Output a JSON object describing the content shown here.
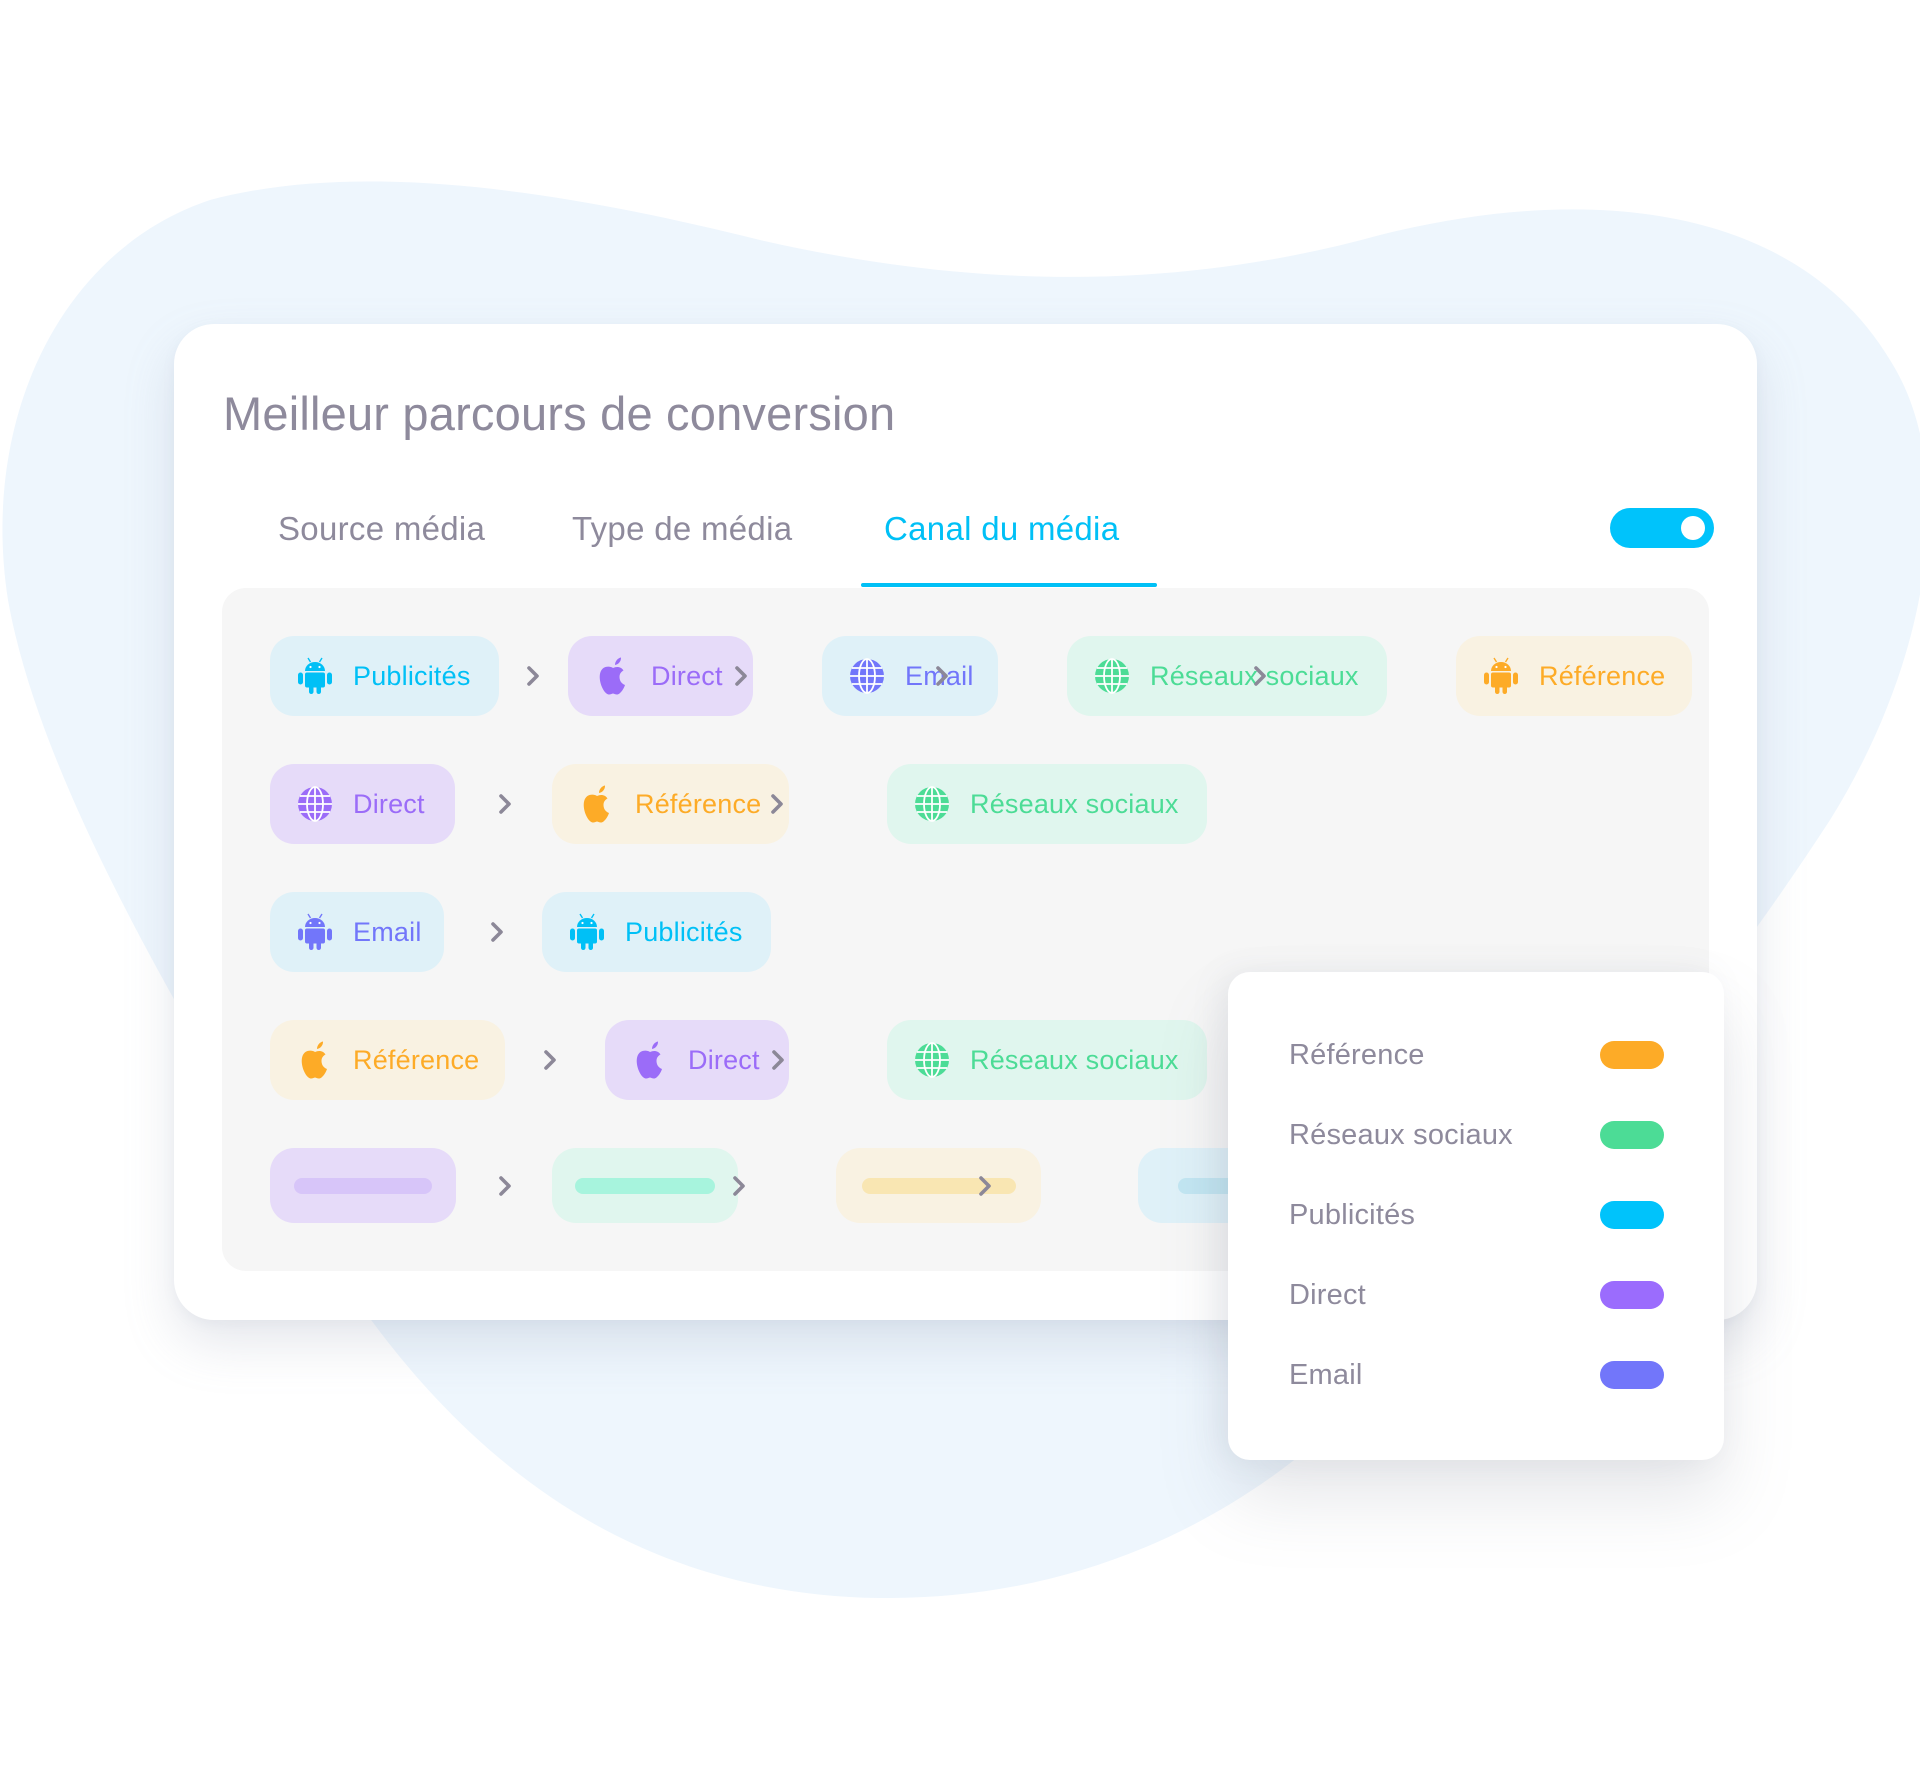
{
  "title": "Meilleur parcours de conversion",
  "tabs": [
    {
      "label": "Source média",
      "active": false
    },
    {
      "label": "Type de média",
      "active": false
    },
    {
      "label": "Canal du média",
      "active": true
    }
  ],
  "toggle": {
    "state": "on",
    "color": "#00c3fb"
  },
  "channels": {
    "publicites": {
      "label": "Publicités",
      "color": "#00c0f6",
      "bg": "#dff1f8",
      "placeholder_bar": "#c2e6f2"
    },
    "direct": {
      "label": "Direct",
      "color": "#9b6cf8",
      "bg": "#e6dbf9",
      "placeholder_bar": "#d7c5f9"
    },
    "email": {
      "label": "Email",
      "color": "#7276fa",
      "bg": "#dff1f8",
      "placeholder_bar": "#c2e6f2"
    },
    "reseaux": {
      "label": "Réseaux sociaux",
      "color": "#4cdc96",
      "bg": "#e0f6ee",
      "placeholder_bar": "#a7f4dd"
    },
    "reference": {
      "label": "Référence",
      "color": "#fdab27",
      "bg": "#f9f2e2",
      "placeholder_bar": "#f9e6b2"
    }
  },
  "paths": [
    {
      "steps": [
        {
          "channel": "publicites",
          "label": "Publicités",
          "icon": "android-icon"
        },
        {
          "channel": "direct",
          "label": "Direct",
          "icon": "apple-icon"
        },
        {
          "channel": "email",
          "label": "Email",
          "icon": "globe-icon"
        },
        {
          "channel": "reseaux",
          "label": "Réseaux sociaux",
          "icon": "globe-icon"
        },
        {
          "channel": "reference",
          "label": "Référence",
          "icon": "android-icon"
        }
      ]
    },
    {
      "steps": [
        {
          "channel": "direct",
          "label": "Direct",
          "icon": "globe-icon"
        },
        {
          "channel": "reference",
          "label": "Référence",
          "icon": "apple-icon"
        },
        {
          "channel": "reseaux",
          "label": "Réseaux sociaux",
          "icon": "globe-icon"
        }
      ]
    },
    {
      "steps": [
        {
          "channel": "email",
          "label": "Email",
          "icon": "android-icon"
        },
        {
          "channel": "publicites",
          "label": "Publicités",
          "icon": "android-icon"
        }
      ]
    },
    {
      "steps": [
        {
          "channel": "reference",
          "label": "Référence",
          "icon": "apple-icon"
        },
        {
          "channel": "direct",
          "label": "Direct",
          "icon": "apple-icon"
        },
        {
          "channel": "reseaux",
          "label": "Réseaux sociaux",
          "icon": "globe-icon"
        }
      ]
    },
    {
      "placeholder": true,
      "steps": [
        {
          "channel": "direct"
        },
        {
          "channel": "reseaux"
        },
        {
          "channel": "reference"
        },
        {
          "channel": "publicites"
        }
      ]
    }
  ],
  "legend": [
    {
      "label": "Référence",
      "color": "#fdab27"
    },
    {
      "label": "Réseaux sociaux",
      "color": "#4cdc96"
    },
    {
      "label": "Publicités",
      "color": "#00c3fb"
    },
    {
      "label": "Direct",
      "color": "#9b6cfd"
    },
    {
      "label": "Email",
      "color": "#7276fa"
    }
  ],
  "colors": {
    "accent": "#00c0f6",
    "text_muted": "#8e8a9c",
    "chevron": "#8c8898",
    "blob": "#eef6fd"
  }
}
